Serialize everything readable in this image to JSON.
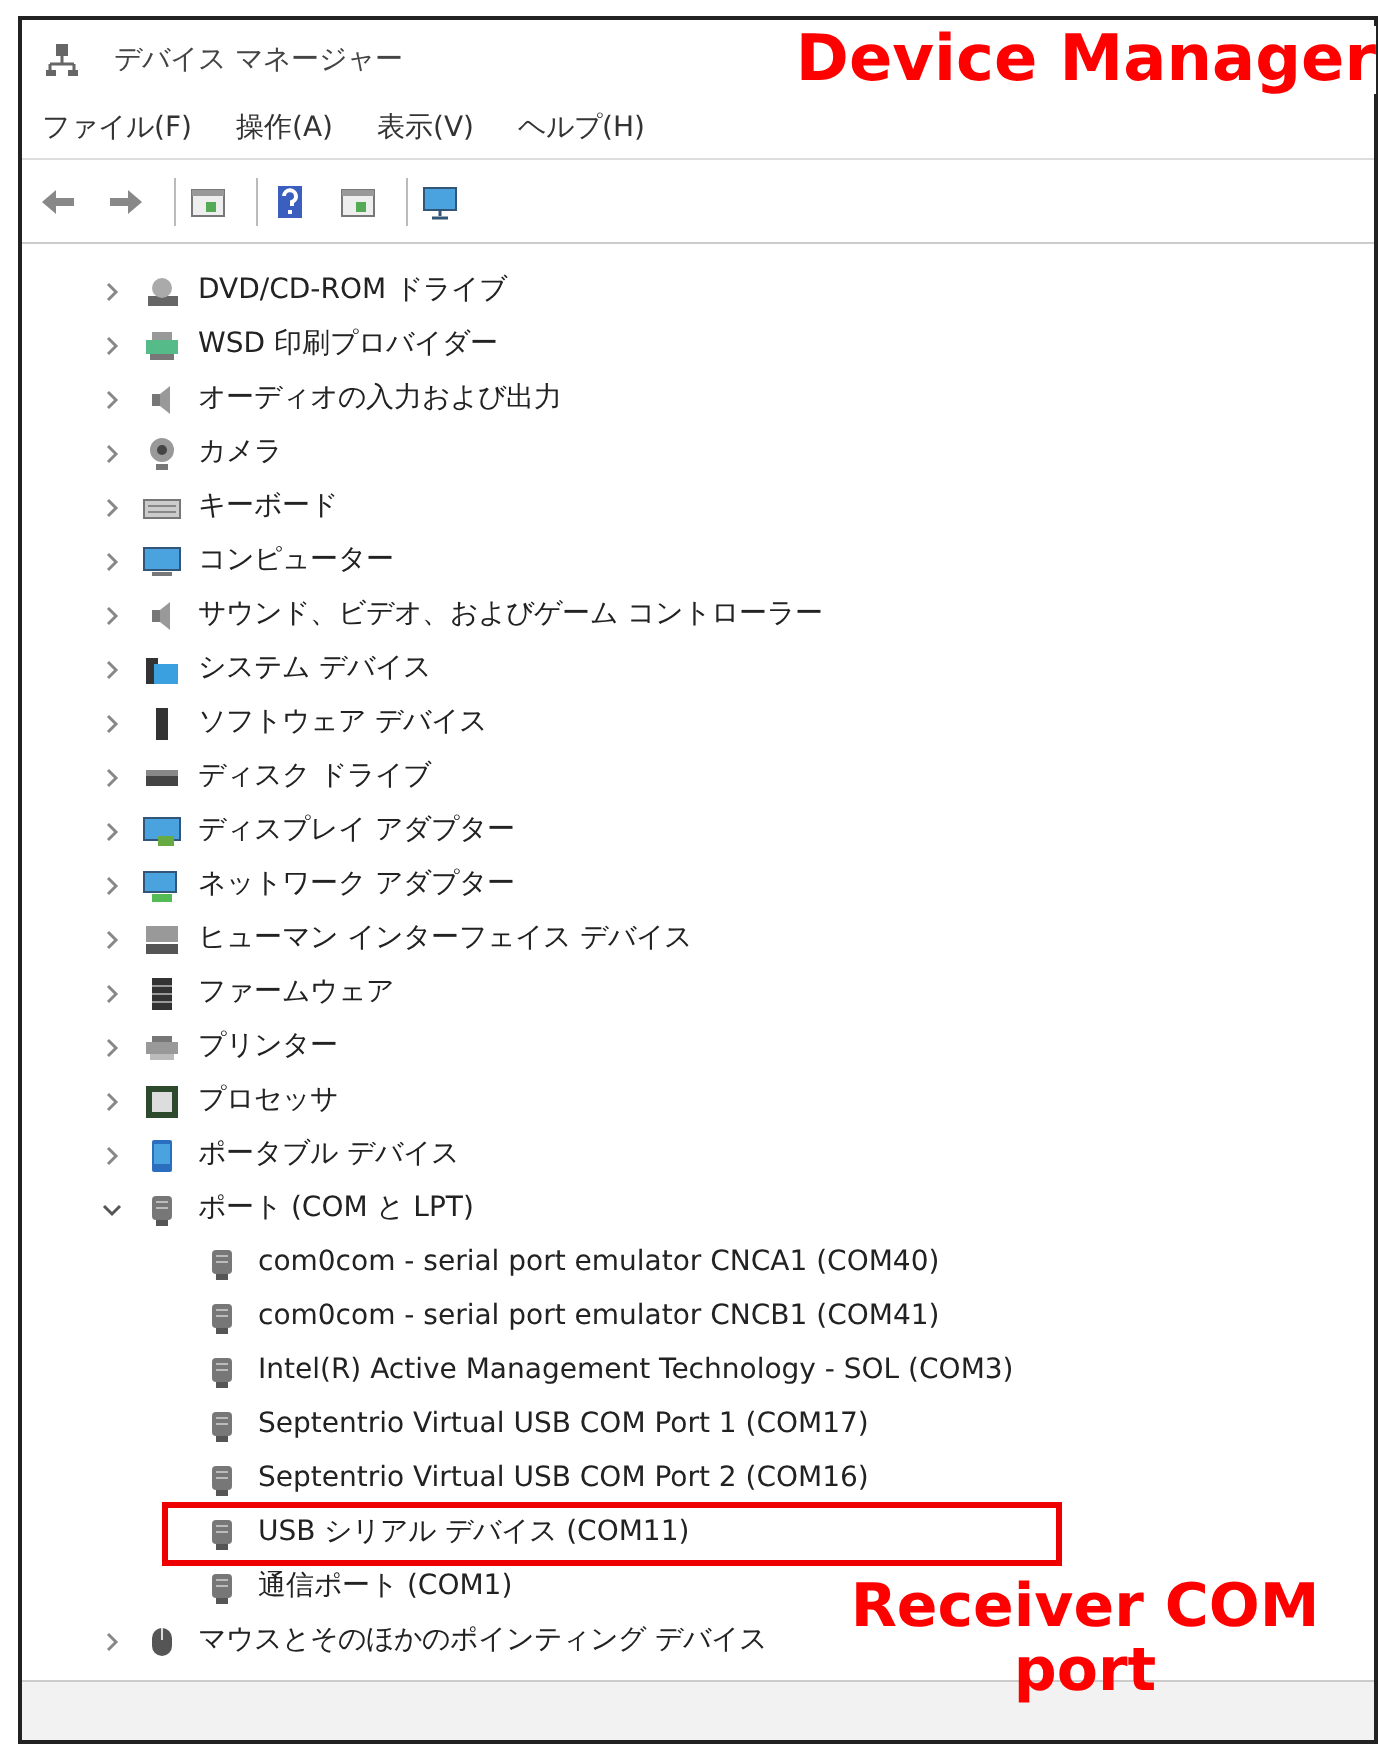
{
  "window": {
    "title": "デバイス マネージャー"
  },
  "menu": [
    "ファイル(F)",
    "操作(A)",
    "表示(V)",
    "ヘルプ(H)"
  ],
  "tree": [
    {
      "label": "DVD/CD-ROM ドライブ",
      "expanded": false
    },
    {
      "label": "WSD 印刷プロバイダー",
      "expanded": false
    },
    {
      "label": "オーディオの入力および出力",
      "expanded": false
    },
    {
      "label": "カメラ",
      "expanded": false
    },
    {
      "label": "キーボード",
      "expanded": false
    },
    {
      "label": "コンピューター",
      "expanded": false
    },
    {
      "label": "サウンド、ビデオ、およびゲーム コントローラー",
      "expanded": false
    },
    {
      "label": "システム デバイス",
      "expanded": false
    },
    {
      "label": "ソフトウェア デバイス",
      "expanded": false
    },
    {
      "label": "ディスク ドライブ",
      "expanded": false
    },
    {
      "label": "ディスプレイ アダプター",
      "expanded": false
    },
    {
      "label": "ネットワーク アダプター",
      "expanded": false
    },
    {
      "label": "ヒューマン インターフェイス デバイス",
      "expanded": false
    },
    {
      "label": "ファームウェア",
      "expanded": false
    },
    {
      "label": "プリンター",
      "expanded": false
    },
    {
      "label": "プロセッサ",
      "expanded": false
    },
    {
      "label": "ポータブル デバイス",
      "expanded": false
    },
    {
      "label": "ポート (COM と LPT)",
      "expanded": true,
      "children": [
        {
          "label": "com0com - serial port emulator CNCA1 (COM40)",
          "boxed": false
        },
        {
          "label": "com0com - serial port emulator CNCB1 (COM41)",
          "boxed": false
        },
        {
          "label": "Intel(R) Active Management Technology - SOL (COM3)",
          "boxed": false
        },
        {
          "label": "Septentrio Virtual USB COM Port 1 (COM17)",
          "boxed": false
        },
        {
          "label": "Septentrio Virtual USB COM Port 2 (COM16)",
          "boxed": false
        },
        {
          "label": "USB シリアル デバイス (COM11)",
          "boxed": true
        },
        {
          "label": "通信ポート (COM1)",
          "boxed": false
        }
      ]
    },
    {
      "label": "マウスとそのほかのポインティング デバイス",
      "expanded": false
    }
  ],
  "annotations": {
    "heading": "Device Manager",
    "callout": "Receiver COM port"
  }
}
